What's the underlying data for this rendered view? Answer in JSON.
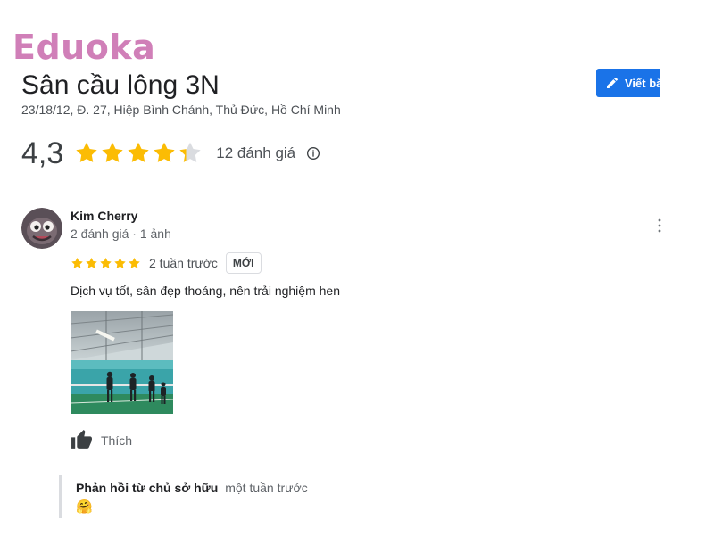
{
  "watermark": "Eduoka",
  "place": {
    "name": "Sân cầu lông 3N",
    "address": "23/18/12, Đ. 27, Hiệp Bình Chánh, Thủ Đức, Hồ Chí Minh"
  },
  "write_review_label": "Viết bài đánh giá",
  "summary": {
    "rating": "4,3",
    "rating_numeric": 4.3,
    "review_count": "12 đánh giá",
    "star_color": "#fbbc04"
  },
  "review": {
    "author": "Kim Cherry",
    "author_meta": "2 đánh giá · 1 ảnh",
    "stars": 5,
    "time": "2 tuần trước",
    "badge": "MỚI",
    "text": "Dịch vụ tốt, sân đẹp thoáng, nên trải nghiệm hen",
    "like_label": "Thích"
  },
  "owner_reply": {
    "label": "Phản hồi từ chủ sở hữu",
    "time": "một tuần trước",
    "text": "🤗"
  },
  "colors": {
    "accent": "#1a73e8",
    "watermark": "#d07fb8"
  }
}
